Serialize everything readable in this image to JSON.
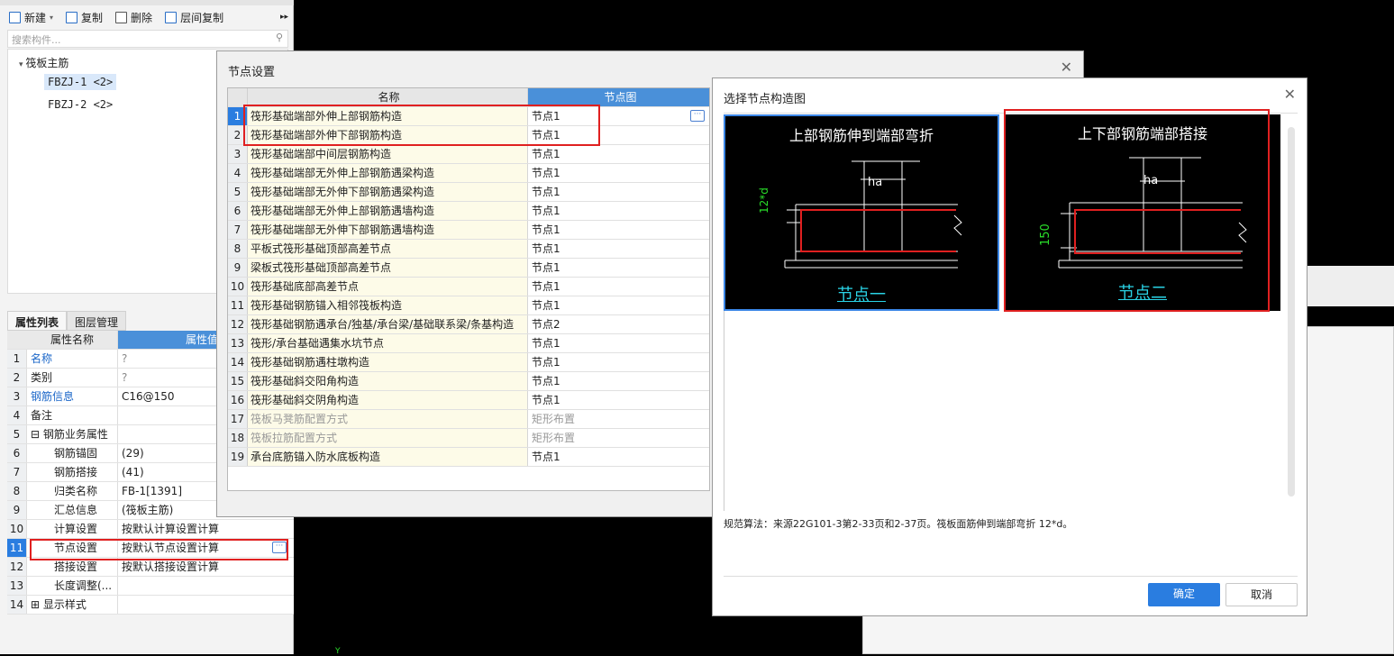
{
  "toolbar": {
    "new": "新建",
    "copy": "复制",
    "delete": "删除",
    "layer_copy": "层间复制"
  },
  "search": {
    "placeholder": "搜索构件..."
  },
  "tree": {
    "root": "筏板主筋",
    "items": [
      "FBZJ-1 <2>",
      "FBZJ-2 <2>"
    ]
  },
  "tabs": [
    "属性列表",
    "图层管理"
  ],
  "props": {
    "col_name": "属性名称",
    "col_value": "属性值",
    "rows": [
      {
        "n": "1",
        "k": "名称",
        "v": "?"
      },
      {
        "n": "2",
        "k": "类别",
        "v": "?"
      },
      {
        "n": "3",
        "k": "钢筋信息",
        "v": "C16@150"
      },
      {
        "n": "4",
        "k": "备注",
        "v": ""
      },
      {
        "n": "5",
        "k": "钢筋业务属性",
        "v": ""
      },
      {
        "n": "6",
        "k": "钢筋锚固",
        "v": "(29)"
      },
      {
        "n": "7",
        "k": "钢筋搭接",
        "v": "(41)"
      },
      {
        "n": "8",
        "k": "归类名称",
        "v": "FB-1[1391]"
      },
      {
        "n": "9",
        "k": "汇总信息",
        "v": "(筏板主筋)"
      },
      {
        "n": "10",
        "k": "计算设置",
        "v": "按默认计算设置计算"
      },
      {
        "n": "11",
        "k": "节点设置",
        "v": "按默认节点设置计算"
      },
      {
        "n": "12",
        "k": "搭接设置",
        "v": "按默认搭接设置计算"
      },
      {
        "n": "13",
        "k": "长度调整(...",
        "v": ""
      },
      {
        "n": "14",
        "k": "显示样式",
        "v": ""
      }
    ]
  },
  "node_dialog": {
    "title": "节点设置",
    "col_name": "名称",
    "col_value": "节点图",
    "rows": [
      {
        "n": "1",
        "k": "筏形基础端部外伸上部钢筋构造",
        "v": "节点1"
      },
      {
        "n": "2",
        "k": "筏形基础端部外伸下部钢筋构造",
        "v": "节点1"
      },
      {
        "n": "3",
        "k": "筏形基础端部中间层钢筋构造",
        "v": "节点1"
      },
      {
        "n": "4",
        "k": "筏形基础端部无外伸上部钢筋遇梁构造",
        "v": "节点1"
      },
      {
        "n": "5",
        "k": "筏形基础端部无外伸下部钢筋遇梁构造",
        "v": "节点1"
      },
      {
        "n": "6",
        "k": "筏形基础端部无外伸上部钢筋遇墙构造",
        "v": "节点1"
      },
      {
        "n": "7",
        "k": "筏形基础端部无外伸下部钢筋遇墙构造",
        "v": "节点1"
      },
      {
        "n": "8",
        "k": "平板式筏形基础顶部高差节点",
        "v": "节点1"
      },
      {
        "n": "9",
        "k": "梁板式筏形基础顶部高差节点",
        "v": "节点1"
      },
      {
        "n": "10",
        "k": "筏形基础底部高差节点",
        "v": "节点1"
      },
      {
        "n": "11",
        "k": "筏形基础钢筋锚入相邻筏板构造",
        "v": "节点1"
      },
      {
        "n": "12",
        "k": "筏形基础钢筋遇承台/独基/承台梁/基础联系梁/条基构造",
        "v": "节点2"
      },
      {
        "n": "13",
        "k": "筏形/承台基础遇集水坑节点",
        "v": "节点1"
      },
      {
        "n": "14",
        "k": "筏形基础钢筋遇柱墩构造",
        "v": "节点1"
      },
      {
        "n": "15",
        "k": "筏形基础斜交阳角构造",
        "v": "节点1"
      },
      {
        "n": "16",
        "k": "筏形基础斜交阴角构造",
        "v": "节点1"
      },
      {
        "n": "17",
        "k": "筏板马凳筋配置方式",
        "v": "矩形布置"
      },
      {
        "n": "18",
        "k": "筏板拉筋配置方式",
        "v": "矩形布置"
      },
      {
        "n": "19",
        "k": "承台底筋锚入防水底板构造",
        "v": "节点1"
      }
    ]
  },
  "pick_dialog": {
    "title": "选择节点构造图",
    "images": [
      {
        "title": "上部钢筋伸到端部弯折",
        "caption": "节点一",
        "dim_left": "12*d",
        "dim_top": "ha"
      },
      {
        "title": "上下部钢筋端部搭接",
        "caption": "节点二",
        "dim_left": "150",
        "dim_top": "ha"
      }
    ],
    "note": "规范算法：来源22G101-3第2-33页和2-37页。筏板面筋伸到端部弯折 12*d。",
    "ok": "确定",
    "cancel": "取消"
  },
  "colors": {
    "accent": "#4a90d9",
    "highlight": "#e02020",
    "caption": "#2ad3e6"
  }
}
